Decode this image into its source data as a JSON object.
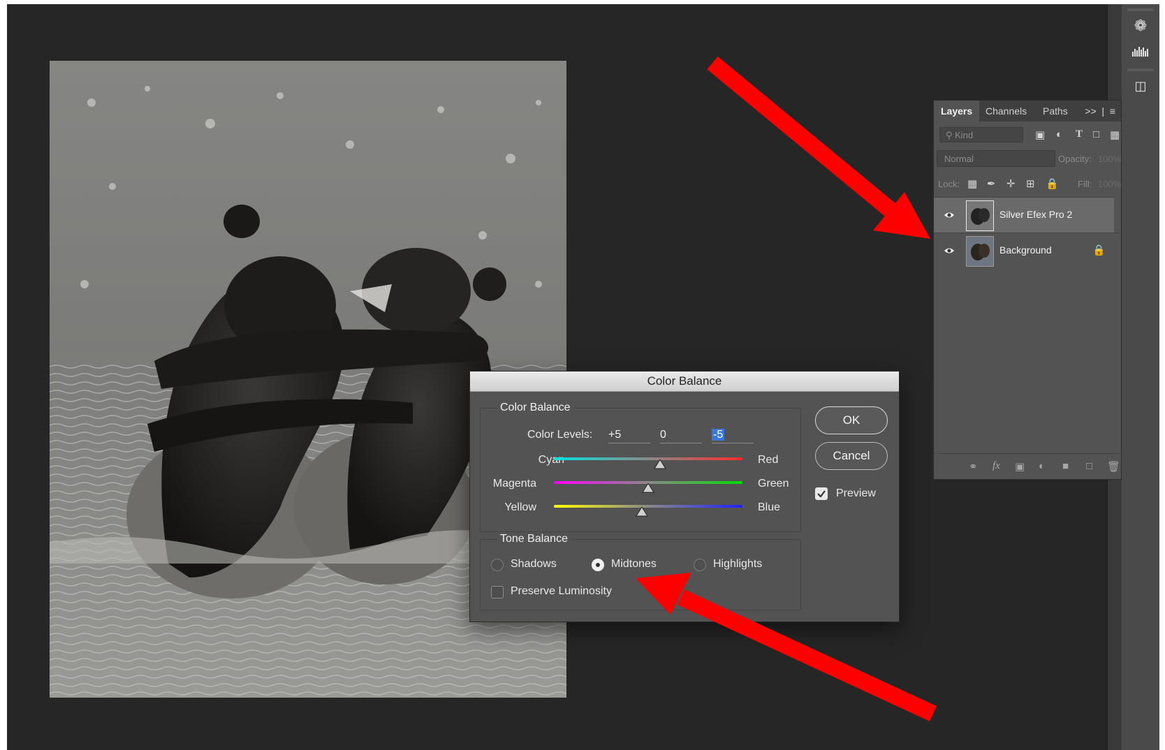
{
  "dialog": {
    "title": "Color Balance",
    "color_balance_group_label": "Color Balance",
    "color_levels_label": "Color Levels:",
    "levels": [
      "+5",
      "0",
      "-5"
    ],
    "sliders": [
      {
        "left_label": "Cyan",
        "right_label": "Red",
        "value": 5
      },
      {
        "left_label": "Magenta",
        "right_label": "Green",
        "value": 0
      },
      {
        "left_label": "Yellow",
        "right_label": "Blue",
        "value": -5
      }
    ],
    "tone_balance_group_label": "Tone Balance",
    "tone_options": [
      "Shadows",
      "Midtones",
      "Highlights"
    ],
    "tone_selected": "Midtones",
    "preserve_luminosity_label": "Preserve Luminosity",
    "preserve_luminosity_checked": false,
    "ok_label": "OK",
    "cancel_label": "Cancel",
    "preview_label": "Preview",
    "preview_checked": true
  },
  "layers_panel": {
    "tabs": [
      "Layers",
      "Channels",
      "Paths"
    ],
    "active_tab": "Layers",
    "overflow_label": ">>",
    "kind_placeholder": "Kind",
    "blend_mode": "Normal",
    "opacity_label": "Opacity:",
    "opacity_value": "100%",
    "lock_label": "Lock:",
    "fill_label": "Fill:",
    "fill_value": "100%",
    "layers": [
      {
        "name": "Silver Efex Pro 2",
        "visible": true,
        "selected": true,
        "locked": false
      },
      {
        "name": "Background",
        "visible": true,
        "selected": false,
        "locked": true
      }
    ]
  },
  "colors": {
    "workspace": "#262626",
    "panel": "#535353",
    "annotation": "#ff0000"
  }
}
